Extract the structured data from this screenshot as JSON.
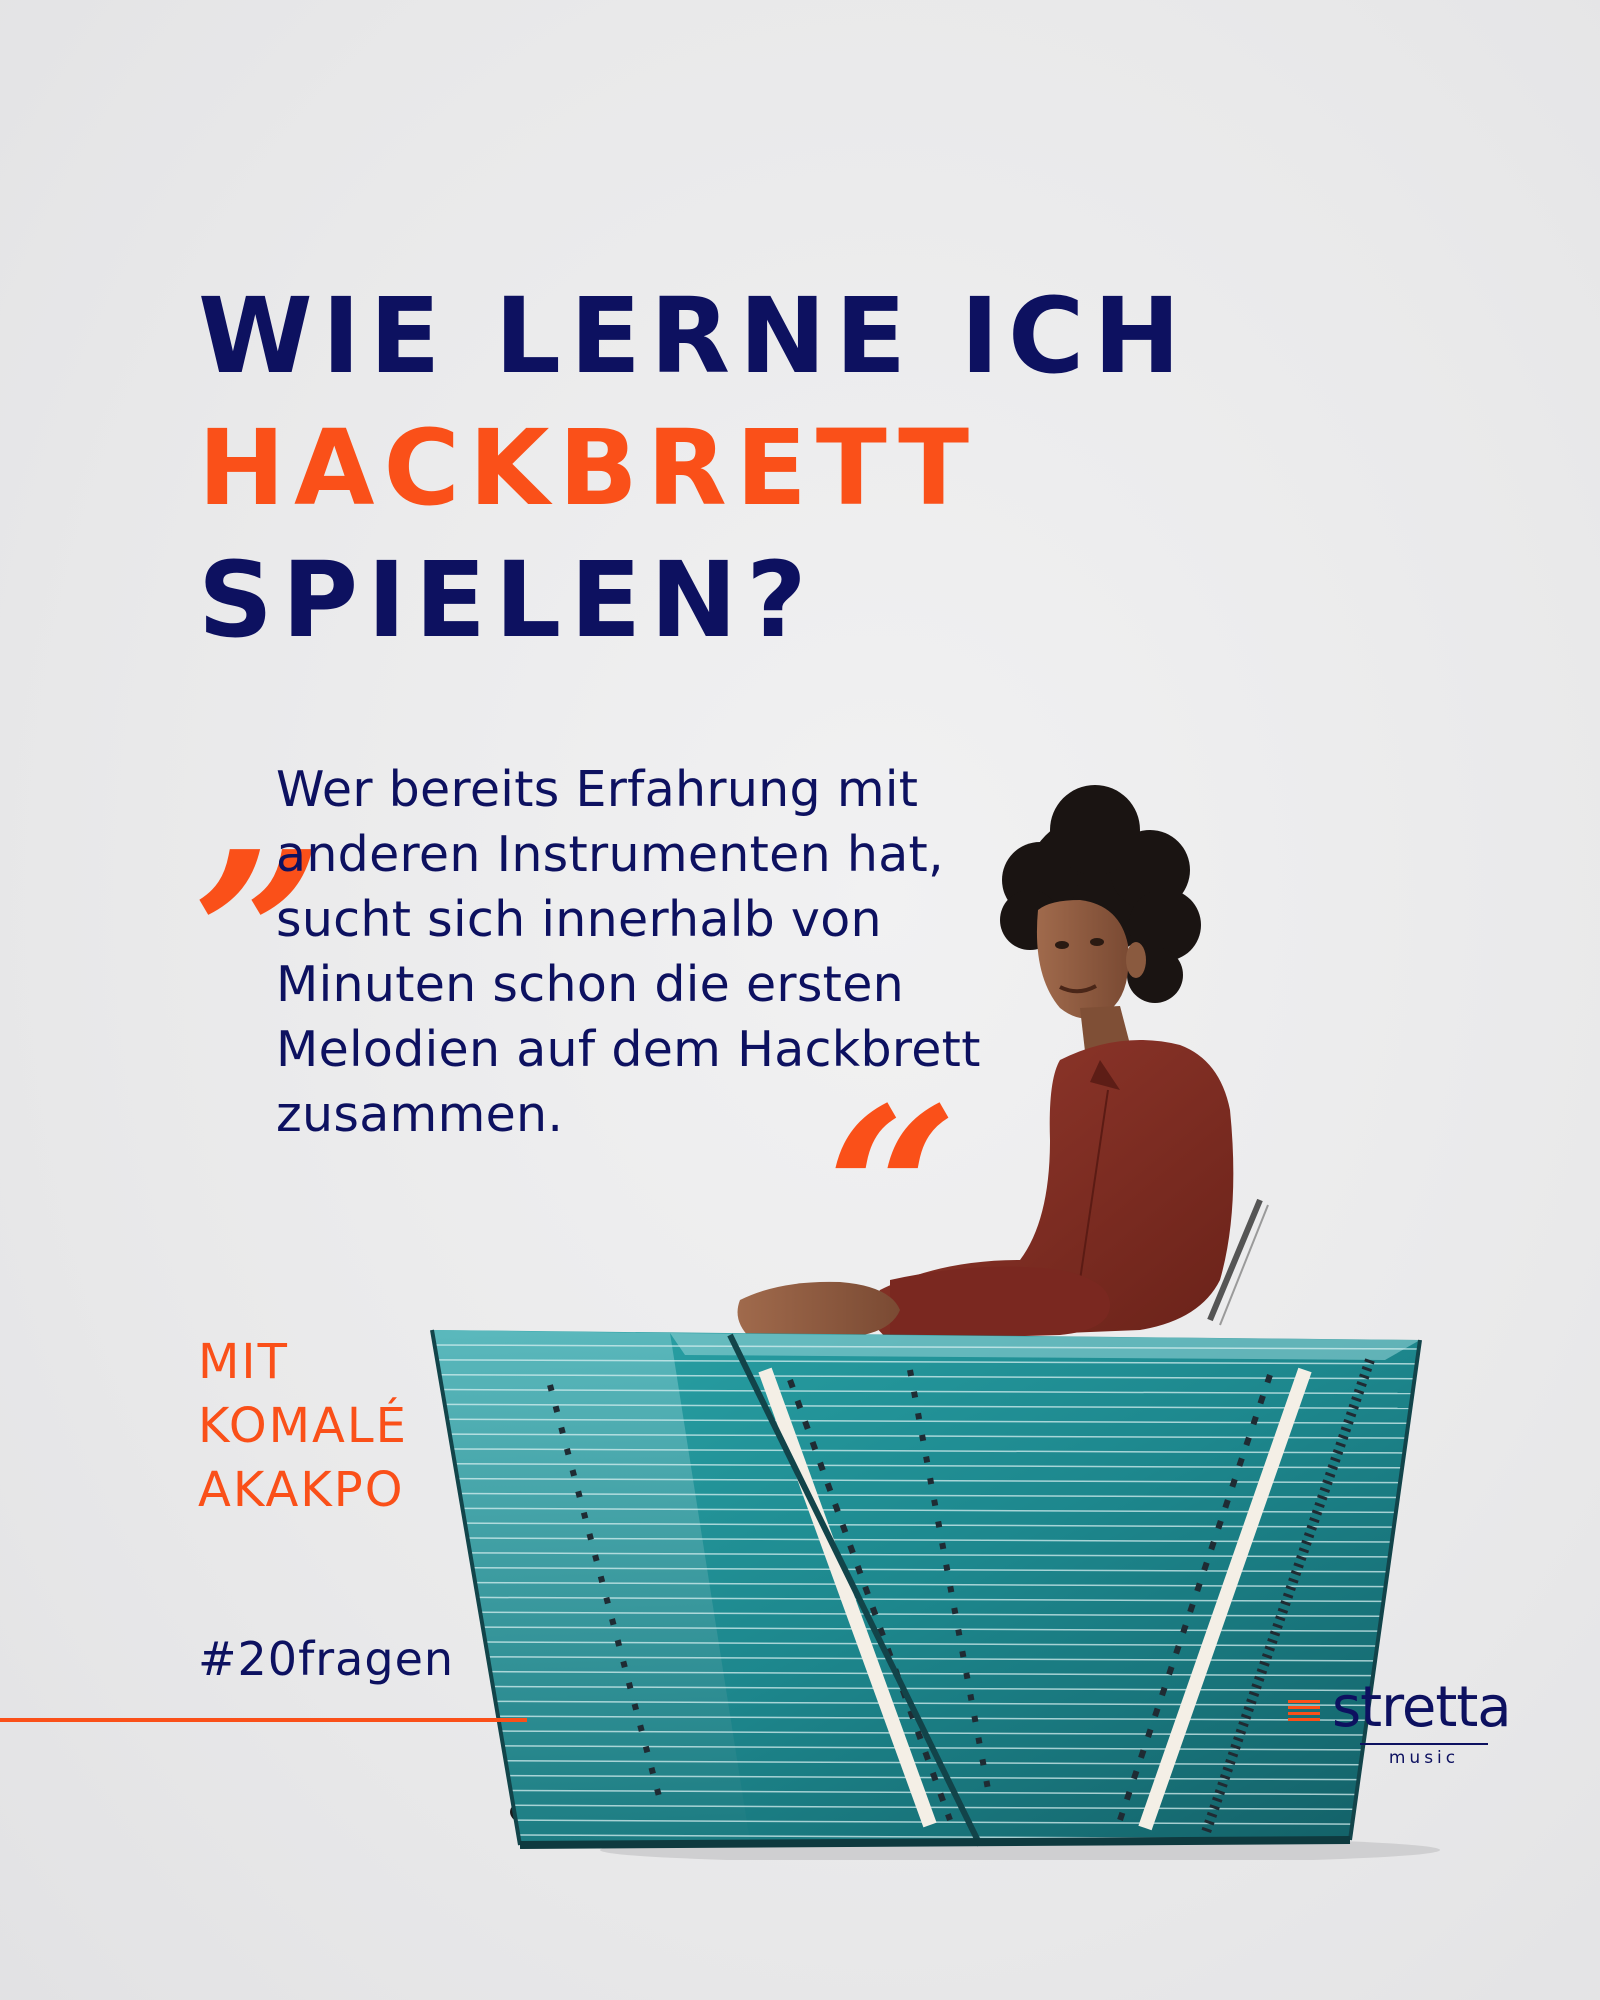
{
  "headline": {
    "line1": "WIE LERNE ICH",
    "line2": "HACKBRETT",
    "line3": "SPIELEN?"
  },
  "quote": {
    "open_mark": "„",
    "close_mark": "“",
    "text": "Wer bereits Erfahrung mit anderen Instrumenten hat, sucht sich innerhalb von Minuten schon die ersten Melodien auf dem Hackbrett zusammen."
  },
  "guest": {
    "line1": "MIT",
    "line2": "KOMALÉ",
    "line3": "AKAKPO"
  },
  "hashtag": "#20fragen",
  "logo": {
    "word": "stretta",
    "sub": "music"
  },
  "colors": {
    "navy": "#0d1160",
    "orange": "#fa5019",
    "background": "#ebebec",
    "instrument": "#1f8c93",
    "shirt": "#7f2e24"
  }
}
